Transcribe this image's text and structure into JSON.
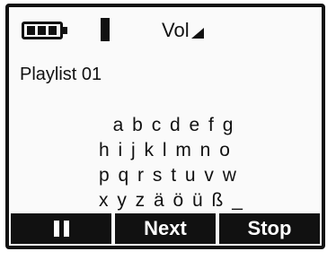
{
  "status": {
    "battery_icon": "battery-icon",
    "signal_icon": "signal-icon",
    "volume_label": "Vol"
  },
  "playlist": {
    "title": "Playlist 01"
  },
  "char_picker": {
    "rows": [
      "  a b c d e f g",
      "h i j k l m n o",
      "p q r s t u v w",
      "x y z ä ö ü ß _"
    ]
  },
  "softkeys": {
    "pause_icon": "pause-icon",
    "next_label": "Next",
    "stop_label": "Stop"
  }
}
